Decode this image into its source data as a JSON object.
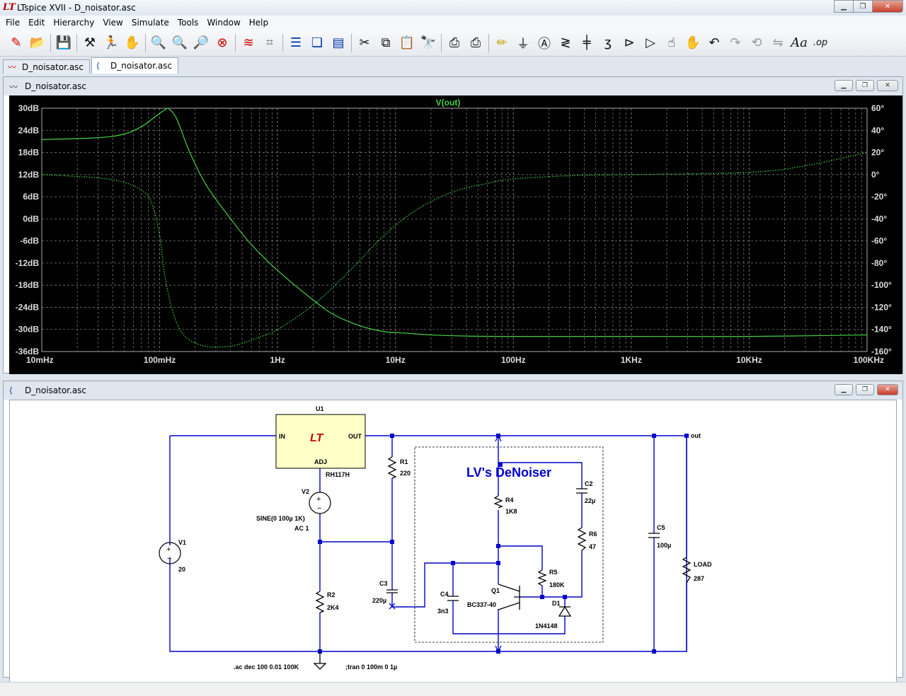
{
  "window": {
    "title": "LTspice XVII - D_noisator.asc",
    "app_icon": "ltspice-icon"
  },
  "menu": [
    "File",
    "Edit",
    "Hierarchy",
    "View",
    "Simulate",
    "Tools",
    "Window",
    "Help"
  ],
  "toolbar_icons": [
    "new-schematic-icon",
    "open-icon",
    "save-icon",
    "control-panel-icon",
    "run-icon",
    "halt-icon",
    "zoom-in-icon",
    "zoom-pan-icon",
    "zoom-out-icon",
    "zoom-fit-icon",
    "autorange-icon",
    "delete-trace-icon",
    "tile-horizontal-icon",
    "cascade-icon",
    "tile-vertical-icon",
    "cut-icon",
    "copy-icon",
    "paste-icon",
    "find-icon",
    "print-icon",
    "print-setup-icon",
    "draw-wire-icon",
    "ground-icon",
    "label-icon",
    "resistor-icon",
    "capacitor-icon",
    "inductor-icon",
    "diode-icon",
    "component-icon",
    "move-icon",
    "drag-icon",
    "undo-icon",
    "redo-icon",
    "rotate-icon",
    "mirror-icon",
    "text-icon",
    "spice-directive-icon"
  ],
  "tabs": [
    {
      "label": "D_noisator.asc",
      "icon": "waveform-tab-icon",
      "active": false
    },
    {
      "label": "D_noisator.asc",
      "icon": "schematic-tab-icon",
      "active": true
    }
  ],
  "plot_window": {
    "title": "D_noisator.asc"
  },
  "schematic_window": {
    "title": "D_noisator.asc"
  },
  "chart_data": {
    "type": "line",
    "title": "V(out)",
    "x_scale": "log",
    "xlim": [
      0.01,
      100000
    ],
    "x_tick_labels": [
      "10mHz",
      "100mHz",
      "1Hz",
      "10Hz",
      "100Hz",
      "1KHz",
      "10KHz",
      "100KHz"
    ],
    "y_left_label_unit": "dB",
    "ylim_left": [
      -36,
      30
    ],
    "y_left_tick_labels": [
      "30dB",
      "24dB",
      "18dB",
      "12dB",
      "6dB",
      "0dB",
      "-6dB",
      "-12dB",
      "-18dB",
      "-24dB",
      "-30dB",
      "-36dB"
    ],
    "ylim_right": [
      -160,
      60
    ],
    "y_right_tick_labels": [
      "60°",
      "40°",
      "20°",
      "0°",
      "-20°",
      "-40°",
      "-60°",
      "-80°",
      "-100°",
      "-120°",
      "-140°",
      "-160°"
    ],
    "grid": true,
    "series": [
      {
        "name": "V(out)",
        "style": "solid",
        "axis": "left",
        "color": "#44d444",
        "x": [
          0.01,
          0.03,
          0.05,
          0.07,
          0.09,
          0.11,
          0.12,
          0.14,
          0.18,
          0.25,
          0.4,
          0.6,
          1,
          2,
          3,
          5,
          8,
          12,
          20,
          40,
          100,
          1000,
          10000,
          100000
        ],
        "y": [
          21.5,
          22,
          23,
          25,
          27.5,
          29.5,
          29.8,
          27,
          18,
          9,
          0,
          -7,
          -14,
          -22,
          -26,
          -29,
          -30.6,
          -31,
          -31.5,
          -31.8,
          -31.9,
          -31.9,
          -31.9,
          -31.5
        ]
      },
      {
        "name": "phase",
        "style": "dotted",
        "axis": "right",
        "color": "#44d444",
        "x": [
          0.01,
          0.03,
          0.05,
          0.07,
          0.085,
          0.1,
          0.11,
          0.13,
          0.16,
          0.22,
          0.3,
          0.45,
          0.7,
          1,
          2,
          4,
          8,
          15,
          30,
          60,
          100,
          300,
          1000,
          10000,
          30000,
          100000
        ],
        "y": [
          0,
          -3,
          -7,
          -14,
          -25,
          -55,
          -90,
          -125,
          -145,
          -154,
          -156,
          -154,
          -147,
          -140,
          -118,
          -88,
          -55,
          -32,
          -16,
          -8,
          -4,
          -1,
          0,
          2,
          8,
          20
        ]
      }
    ]
  },
  "schematic": {
    "components": {
      "u1": {
        "ref": "U1",
        "model": "RH117H",
        "pin_in": "IN",
        "pin_out": "OUT",
        "pin_adj": "ADJ"
      },
      "v1": {
        "ref": "V1",
        "value": "20"
      },
      "v2": {
        "ref": "V2",
        "value1": "SINE(0 100µ 1K)",
        "value2": "AC 1"
      },
      "r1": {
        "ref": "R1",
        "value": "220"
      },
      "r2": {
        "ref": "R2",
        "value": "2K4"
      },
      "r4": {
        "ref": "R4",
        "value": "1K8"
      },
      "r5": {
        "ref": "R5",
        "value": "180K"
      },
      "r6": {
        "ref": "R6",
        "value": "47"
      },
      "c2": {
        "ref": "C2",
        "value": "22µ"
      },
      "c3": {
        "ref": "C3",
        "value": "220µ"
      },
      "c4": {
        "ref": "C4",
        "value": "3n3"
      },
      "c5": {
        "ref": "C5",
        "value": "100µ"
      },
      "q1": {
        "ref": "Q1",
        "model": "BC337-40"
      },
      "d1": {
        "ref": "D1",
        "model": "1N4148"
      },
      "load": {
        "ref": "LOAD",
        "value": "287"
      }
    },
    "net_label_out": "out",
    "title_text": "LV's DeNoiser",
    "directive_ac": ".ac dec 100 0.01 100K",
    "directive_tran": ";tran 0 100m 0 1µ"
  }
}
